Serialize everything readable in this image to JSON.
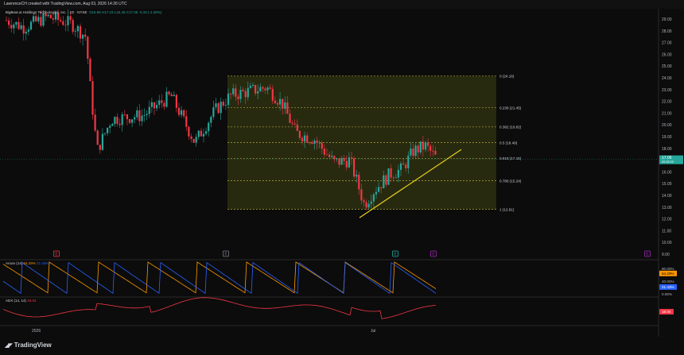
{
  "header": {
    "caption": "LawrenceCH created with TradingView.com, Aug 03, 2026 14:26 UTC"
  },
  "legend": {
    "symbol": "BigBear.ai Holdings Technologies, Inc. · 1D · NYSE",
    "ohlc": "O16.96 H17.23 L16.45 C17.06 -0.33 (-1.38%)"
  },
  "price_axis": {
    "ticks": [
      "29.00",
      "28.00",
      "27.00",
      "26.00",
      "25.00",
      "24.00",
      "23.00",
      "22.00",
      "21.00",
      "20.00",
      "19.00",
      "18.00",
      "17.00",
      "16.00",
      "15.00",
      "14.00",
      "13.00",
      "12.00",
      "11.00",
      "10.00",
      "9.00"
    ],
    "last_price": "17.06",
    "last_countdown": "09:33:09",
    "last_color": "#26a69a"
  },
  "fib": {
    "levels": [
      {
        "ratio": "0",
        "label": "0 (24.16)",
        "price": 24.16
      },
      {
        "ratio": "0.236",
        "label": "0.236 (21.45)",
        "price": 21.45
      },
      {
        "ratio": "0.382",
        "label": "0.382 (19.82)",
        "price": 19.82
      },
      {
        "ratio": "0.5",
        "label": "0.5 (18.49)",
        "price": 18.49
      },
      {
        "ratio": "0.618",
        "label": "0.618 (17.15)",
        "price": 17.15
      },
      {
        "ratio": "0.786",
        "label": "0.786 (15.24)",
        "price": 15.24
      },
      {
        "ratio": "1",
        "label": "1 (12.81)",
        "price": 12.81
      }
    ],
    "fill_color": "#2e3012",
    "line_color": "#c9c23a"
  },
  "event_markers": [
    {
      "letter": "E",
      "color": "#f23645"
    },
    {
      "letter": "E",
      "color": "#787b86"
    },
    {
      "letter": "E",
      "color": "#26a69a"
    },
    {
      "letter": "E",
      "color": "#9c27b0"
    },
    {
      "letter": "E",
      "color": "#9c27b0"
    }
  ],
  "aroon": {
    "label": "Aroon (14)",
    "up_value": "64.29%",
    "down_value": "21.43%",
    "up_color": "#ff9800",
    "down_color": "#2962ff",
    "axis": [
      "80.00%",
      "40.00%",
      "0.00%"
    ]
  },
  "adx": {
    "label": "ADX (14, 14)",
    "value": "18.04",
    "color": "#f23645"
  },
  "time_axis": {
    "ticks": [
      "2026",
      "Jul"
    ]
  },
  "footer": {
    "brand": "TradingView"
  },
  "chart_data": {
    "type": "candlestick",
    "series_note": "OHLC daily candles with Fibonacci retracement, trendline, Aroon and ADX panes",
    "ylim": [
      9,
      29.5
    ],
    "fib_range": [
      12.81,
      24.16
    ],
    "trendline": {
      "from": 12.1,
      "to": 17.9
    },
    "last_close": 17.06
  }
}
